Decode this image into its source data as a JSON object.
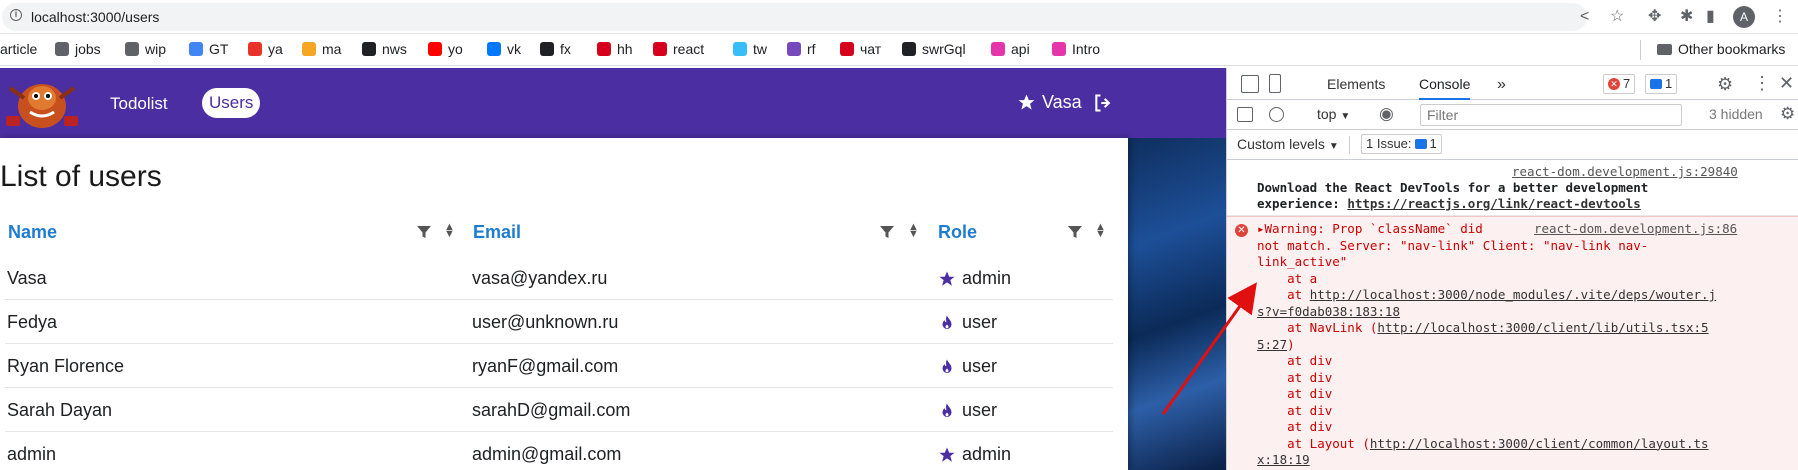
{
  "address": {
    "url": "localhost:3000/users"
  },
  "bookmarks": [
    {
      "label": "article",
      "color": "#555"
    },
    {
      "label": "jobs",
      "color": "#5f6368"
    },
    {
      "label": "wip",
      "color": "#5f6368"
    },
    {
      "label": "GT",
      "color": "#4285f4"
    },
    {
      "label": "ya",
      "color": "#e8332a"
    },
    {
      "label": "ma",
      "color": "#f5a623"
    },
    {
      "label": "nws",
      "color": "#202124"
    },
    {
      "label": "yo",
      "color": "#ff0000"
    },
    {
      "label": "vk",
      "color": "#0077ff"
    },
    {
      "label": "fx",
      "color": "#202124"
    },
    {
      "label": "hh",
      "color": "#d6001c"
    },
    {
      "label": "react",
      "color": "#d6001c"
    },
    {
      "label": "tw",
      "color": "#38bdf8"
    },
    {
      "label": "rf",
      "color": "#764abc"
    },
    {
      "label": "чат",
      "color": "#d6001c"
    },
    {
      "label": "swrGql",
      "color": "#202124"
    },
    {
      "label": "api",
      "color": "#e535ab"
    },
    {
      "label": "Intro",
      "color": "#e535ab"
    }
  ],
  "other_bookmarks": "Other bookmarks",
  "avatar_letter": "A",
  "app": {
    "nav": {
      "todolist": "Todolist",
      "users": "Users"
    },
    "current_user": "Vasa",
    "page_title": "List of users",
    "columns": [
      "Name",
      "Email",
      "Role"
    ],
    "rows": [
      {
        "name": "Vasa",
        "email": "vasa@yandex.ru",
        "role": "admin",
        "role_icon": "star-icon"
      },
      {
        "name": "Fedya",
        "email": "user@unknown.ru",
        "role": "user",
        "role_icon": "flame-icon"
      },
      {
        "name": "Ryan Florence",
        "email": "ryanF@gmail.com",
        "role": "user",
        "role_icon": "flame-icon"
      },
      {
        "name": "Sarah Dayan",
        "email": "sarahD@gmail.com",
        "role": "user",
        "role_icon": "flame-icon"
      },
      {
        "name": "admin",
        "email": "admin@gmail.com",
        "role": "admin",
        "role_icon": "star-icon"
      }
    ],
    "accent": "#4c2ea3",
    "header_link_color": "#1f7cd1"
  },
  "devtools": {
    "tabs": [
      "Elements",
      "Console"
    ],
    "error_count": "7",
    "message_count": "1",
    "context": "top",
    "filter_placeholder": "Filter",
    "hidden": "3 hidden",
    "levels": "Custom levels",
    "issues_label": "1 Issue:",
    "issues_count": "1",
    "messages": {
      "info_source": "react-dom.development.js:29840",
      "info_line1": "Download the React DevTools for a better development",
      "info_line2_prefix": "experience: ",
      "info_link": "https://reactjs.org/link/react-devtools",
      "warn_source": "react-dom.development.js:86",
      "warn_lines": [
        "▸Warning: Prop `className` did",
        "not match. Server: \"nav-link\" Client: \"nav-link nav-",
        "link_active\"",
        "    at a"
      ],
      "stack1_prefix": "    at ",
      "stack1_link": "http://localhost:3000/node_modules/.vite/deps/wouter.j",
      "stack1_cont": "s?v=f0dab038:183:18",
      "stack2_prefix": "    at NavLink (",
      "stack2_link": "http://localhost:3000/client/lib/utils.tsx:5",
      "stack2_cont": "5:27",
      "stack2_suffix": ")",
      "divs": [
        "    at div",
        "    at div",
        "    at div",
        "    at div",
        "    at div"
      ],
      "stack3_prefix": "    at Layout (",
      "stack3_link": "http://localhost:3000/client/common/layout.ts",
      "stack3_cont": "x:18:19"
    }
  }
}
